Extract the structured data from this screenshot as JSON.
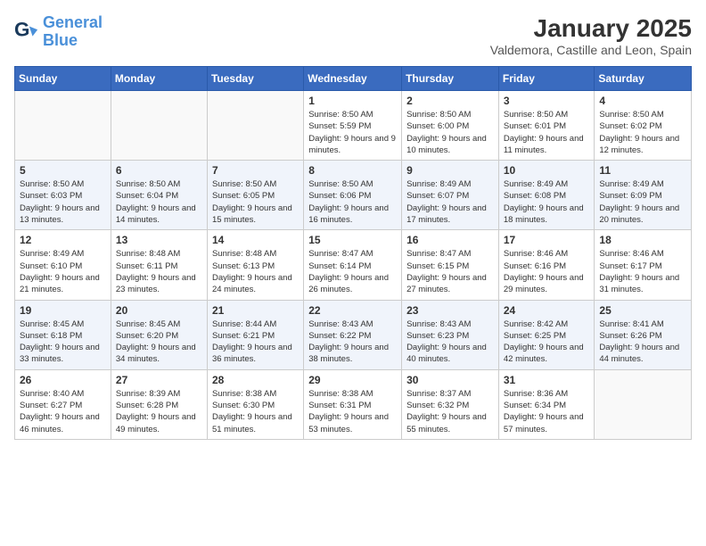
{
  "header": {
    "logo_line1": "General",
    "logo_line2": "Blue",
    "month_year": "January 2025",
    "location": "Valdemora, Castille and Leon, Spain"
  },
  "weekdays": [
    "Sunday",
    "Monday",
    "Tuesday",
    "Wednesday",
    "Thursday",
    "Friday",
    "Saturday"
  ],
  "weeks": [
    [
      {
        "day": "",
        "sunrise": "",
        "sunset": "",
        "daylight": ""
      },
      {
        "day": "",
        "sunrise": "",
        "sunset": "",
        "daylight": ""
      },
      {
        "day": "",
        "sunrise": "",
        "sunset": "",
        "daylight": ""
      },
      {
        "day": "1",
        "sunrise": "Sunrise: 8:50 AM",
        "sunset": "Sunset: 5:59 PM",
        "daylight": "Daylight: 9 hours and 9 minutes."
      },
      {
        "day": "2",
        "sunrise": "Sunrise: 8:50 AM",
        "sunset": "Sunset: 6:00 PM",
        "daylight": "Daylight: 9 hours and 10 minutes."
      },
      {
        "day": "3",
        "sunrise": "Sunrise: 8:50 AM",
        "sunset": "Sunset: 6:01 PM",
        "daylight": "Daylight: 9 hours and 11 minutes."
      },
      {
        "day": "4",
        "sunrise": "Sunrise: 8:50 AM",
        "sunset": "Sunset: 6:02 PM",
        "daylight": "Daylight: 9 hours and 12 minutes."
      }
    ],
    [
      {
        "day": "5",
        "sunrise": "Sunrise: 8:50 AM",
        "sunset": "Sunset: 6:03 PM",
        "daylight": "Daylight: 9 hours and 13 minutes."
      },
      {
        "day": "6",
        "sunrise": "Sunrise: 8:50 AM",
        "sunset": "Sunset: 6:04 PM",
        "daylight": "Daylight: 9 hours and 14 minutes."
      },
      {
        "day": "7",
        "sunrise": "Sunrise: 8:50 AM",
        "sunset": "Sunset: 6:05 PM",
        "daylight": "Daylight: 9 hours and 15 minutes."
      },
      {
        "day": "8",
        "sunrise": "Sunrise: 8:50 AM",
        "sunset": "Sunset: 6:06 PM",
        "daylight": "Daylight: 9 hours and 16 minutes."
      },
      {
        "day": "9",
        "sunrise": "Sunrise: 8:49 AM",
        "sunset": "Sunset: 6:07 PM",
        "daylight": "Daylight: 9 hours and 17 minutes."
      },
      {
        "day": "10",
        "sunrise": "Sunrise: 8:49 AM",
        "sunset": "Sunset: 6:08 PM",
        "daylight": "Daylight: 9 hours and 18 minutes."
      },
      {
        "day": "11",
        "sunrise": "Sunrise: 8:49 AM",
        "sunset": "Sunset: 6:09 PM",
        "daylight": "Daylight: 9 hours and 20 minutes."
      }
    ],
    [
      {
        "day": "12",
        "sunrise": "Sunrise: 8:49 AM",
        "sunset": "Sunset: 6:10 PM",
        "daylight": "Daylight: 9 hours and 21 minutes."
      },
      {
        "day": "13",
        "sunrise": "Sunrise: 8:48 AM",
        "sunset": "Sunset: 6:11 PM",
        "daylight": "Daylight: 9 hours and 23 minutes."
      },
      {
        "day": "14",
        "sunrise": "Sunrise: 8:48 AM",
        "sunset": "Sunset: 6:13 PM",
        "daylight": "Daylight: 9 hours and 24 minutes."
      },
      {
        "day": "15",
        "sunrise": "Sunrise: 8:47 AM",
        "sunset": "Sunset: 6:14 PM",
        "daylight": "Daylight: 9 hours and 26 minutes."
      },
      {
        "day": "16",
        "sunrise": "Sunrise: 8:47 AM",
        "sunset": "Sunset: 6:15 PM",
        "daylight": "Daylight: 9 hours and 27 minutes."
      },
      {
        "day": "17",
        "sunrise": "Sunrise: 8:46 AM",
        "sunset": "Sunset: 6:16 PM",
        "daylight": "Daylight: 9 hours and 29 minutes."
      },
      {
        "day": "18",
        "sunrise": "Sunrise: 8:46 AM",
        "sunset": "Sunset: 6:17 PM",
        "daylight": "Daylight: 9 hours and 31 minutes."
      }
    ],
    [
      {
        "day": "19",
        "sunrise": "Sunrise: 8:45 AM",
        "sunset": "Sunset: 6:18 PM",
        "daylight": "Daylight: 9 hours and 33 minutes."
      },
      {
        "day": "20",
        "sunrise": "Sunrise: 8:45 AM",
        "sunset": "Sunset: 6:20 PM",
        "daylight": "Daylight: 9 hours and 34 minutes."
      },
      {
        "day": "21",
        "sunrise": "Sunrise: 8:44 AM",
        "sunset": "Sunset: 6:21 PM",
        "daylight": "Daylight: 9 hours and 36 minutes."
      },
      {
        "day": "22",
        "sunrise": "Sunrise: 8:43 AM",
        "sunset": "Sunset: 6:22 PM",
        "daylight": "Daylight: 9 hours and 38 minutes."
      },
      {
        "day": "23",
        "sunrise": "Sunrise: 8:43 AM",
        "sunset": "Sunset: 6:23 PM",
        "daylight": "Daylight: 9 hours and 40 minutes."
      },
      {
        "day": "24",
        "sunrise": "Sunrise: 8:42 AM",
        "sunset": "Sunset: 6:25 PM",
        "daylight": "Daylight: 9 hours and 42 minutes."
      },
      {
        "day": "25",
        "sunrise": "Sunrise: 8:41 AM",
        "sunset": "Sunset: 6:26 PM",
        "daylight": "Daylight: 9 hours and 44 minutes."
      }
    ],
    [
      {
        "day": "26",
        "sunrise": "Sunrise: 8:40 AM",
        "sunset": "Sunset: 6:27 PM",
        "daylight": "Daylight: 9 hours and 46 minutes."
      },
      {
        "day": "27",
        "sunrise": "Sunrise: 8:39 AM",
        "sunset": "Sunset: 6:28 PM",
        "daylight": "Daylight: 9 hours and 49 minutes."
      },
      {
        "day": "28",
        "sunrise": "Sunrise: 8:38 AM",
        "sunset": "Sunset: 6:30 PM",
        "daylight": "Daylight: 9 hours and 51 minutes."
      },
      {
        "day": "29",
        "sunrise": "Sunrise: 8:38 AM",
        "sunset": "Sunset: 6:31 PM",
        "daylight": "Daylight: 9 hours and 53 minutes."
      },
      {
        "day": "30",
        "sunrise": "Sunrise: 8:37 AM",
        "sunset": "Sunset: 6:32 PM",
        "daylight": "Daylight: 9 hours and 55 minutes."
      },
      {
        "day": "31",
        "sunrise": "Sunrise: 8:36 AM",
        "sunset": "Sunset: 6:34 PM",
        "daylight": "Daylight: 9 hours and 57 minutes."
      },
      {
        "day": "",
        "sunrise": "",
        "sunset": "",
        "daylight": ""
      }
    ]
  ]
}
